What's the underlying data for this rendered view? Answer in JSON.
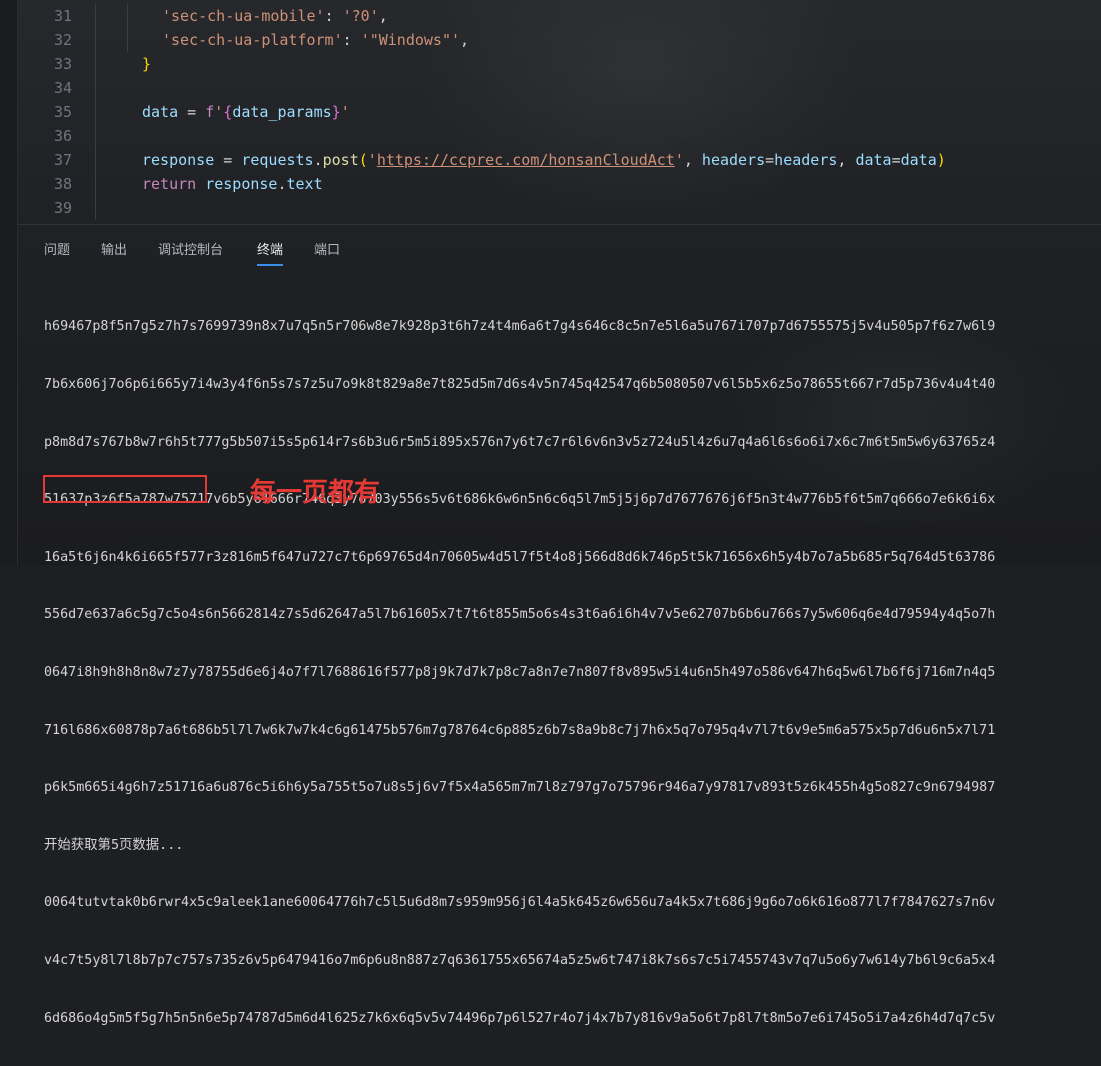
{
  "editor": {
    "lines": [
      {
        "no": "31",
        "parts": [
          [
            "str",
            "'sec-ch-ua-mobile'"
          ],
          [
            "pl",
            ": "
          ],
          [
            "str",
            "'?0'"
          ],
          [
            "pl",
            ","
          ]
        ]
      },
      {
        "no": "32",
        "parts": [
          [
            "str",
            "'sec-ch-ua-platform'"
          ],
          [
            "pl",
            ": "
          ],
          [
            "str",
            "'\"Windows\"'"
          ],
          [
            "pl",
            ","
          ]
        ]
      },
      {
        "no": "33",
        "parts": [
          [
            "br",
            "}"
          ]
        ]
      },
      {
        "no": "34",
        "parts": []
      },
      {
        "no": "35",
        "parts": [
          [
            "var",
            "data"
          ],
          [
            "pl",
            " = "
          ],
          [
            "kw",
            "f"
          ],
          [
            "str",
            "'"
          ],
          [
            "br2",
            "{"
          ],
          [
            "var",
            "data_params"
          ],
          [
            "br2",
            "}"
          ],
          [
            "str",
            "'"
          ]
        ]
      },
      {
        "no": "36",
        "parts": []
      },
      {
        "no": "37",
        "parts": [
          [
            "var",
            "response"
          ],
          [
            "pl",
            " = "
          ],
          [
            "var",
            "requests"
          ],
          [
            "pl",
            "."
          ],
          [
            "fn",
            "post"
          ],
          [
            "br",
            "("
          ],
          [
            "str",
            "'"
          ],
          [
            "url",
            "https://ccprec.com/honsanCloudAct"
          ],
          [
            "str",
            "'"
          ],
          [
            "pl",
            ", "
          ],
          [
            "var",
            "headers"
          ],
          [
            "pl",
            "="
          ],
          [
            "var",
            "headers"
          ],
          [
            "pl",
            ", "
          ],
          [
            "var",
            "data"
          ],
          [
            "pl",
            "="
          ],
          [
            "var",
            "data"
          ],
          [
            "br",
            ")"
          ]
        ]
      },
      {
        "no": "38",
        "parts": [
          [
            "kw",
            "return "
          ],
          [
            "var",
            "response"
          ],
          [
            "pl",
            "."
          ],
          [
            "var",
            "text"
          ]
        ]
      },
      {
        "no": "39",
        "parts": []
      }
    ]
  },
  "panel": {
    "tabs": [
      "问题",
      "输出",
      "调试控制台",
      "终端",
      "端口"
    ],
    "active_tab": "终端"
  },
  "terminal": {
    "lines": [
      "h69467p8f5n7g5z7h7s7699739n8x7u7q5n5r706w8e7k928p3t6h7z4t4m6a6t7g4s646c8c5n7e5l6a5u767i707p7d6755575j5v4u505p7f6z7w6l9",
      "7b6x606j7o6p6i665y7i4w3y4f6n5s7s7z5u7o9k8t829a8e7t825d5m7d6s4v5n745q42547q6b5080507v6l5b5x6z5o78655t667r7d5p736v4u4t40",
      "p8m8d7s767b8w7r6h5t777g5b507i5s5p614r7s6b3u6r5m5i895x576n7y6t7c7r6l6v6n3v5z724u5l4z6u7q4a6l6s6o6i7x6c7m6t5m5w6y63765z4",
      "51637p3z6f5a787w75717v6b5y61666r746q3y7o703y556s5v6t686k6w6n5n6c6q5l7m5j5j6p7d7677676j6f5n3t4w776b5f6t5m7q666o7e6k6i6x",
      "16a5t6j6n4k6i665f577r3z816m5f647u727c7t6p69765d4n70605w4d5l7f5t4o8j566d8d6k746p5t5k71656x6h5y4b7o7a5b685r5q764d5t63786",
      "556d7e637a6c5g7c5o4s6n5662814z7s5d62647a5l7b61605x7t7t6t855m5o6s4s3t6a6i6h4v7v5e62707b6b6u766s7y5w606q6e4d79594y4q5o7h",
      "0647i8h9h8h8n8w7z7y78755d6e6j4o7f7l7688616f577p8j9k7d7k7p8c7a8n7e7n807f8v895w5i4u6n5h497o586v647h6q5w6l7b6f6j716m7n4q5",
      "716l686x60878p7a6t686b5l7l7w6k7w7k4c6g61475b576m7g78764c6p885z6b7s8a9b8c7j7h6x5q7o795q4v7l7t6v9e5m6a575x5p7d6u6n5x7l71",
      "p6k5m665i4g6h7z51716a6u876c5i6h6y5a755t5o7u8s5j6v7f5x4a565m7m7l8z797g7o75796r946a7y97817v893t5z6k455h4g5o827c9n6794987",
      "开始获取第5页数据...",
      "0064tutvtak0b6rwr4x5c9aleek1ane60064776h7c5l5u6d8m7s959m956j6l4a5k645z6w656u7a4k5x7t686j9g6o7o6k616o877l7f7847627s7n6v",
      "v4c7t5y8l7l8b7p7c757s735z6v5p6479416o7m6p6u8n887z7q6361755x65674a5z5w6t747i8k7s6s7c5i7455743v7q7u5o6y7w614y7b6l9c6a5x4",
      "6d686o4g5m5f5g7h5n5n6e5p74787d5m6d4l625z7k6x6q5v5v74496p7p6l527r4o7j4x7b7y816v9a5o6t7p8l7t8m5o7e6i745o5i7a4z6h4d7q7c5v"
    ]
  },
  "annotation": {
    "text": "每一页都有",
    "color": "#e53935"
  },
  "theme": {
    "accent": "#3b8eea",
    "string": "#ce9178",
    "variable": "#9cdcfe",
    "keyword": "#c586c0",
    "function": "#dcdcaa"
  }
}
